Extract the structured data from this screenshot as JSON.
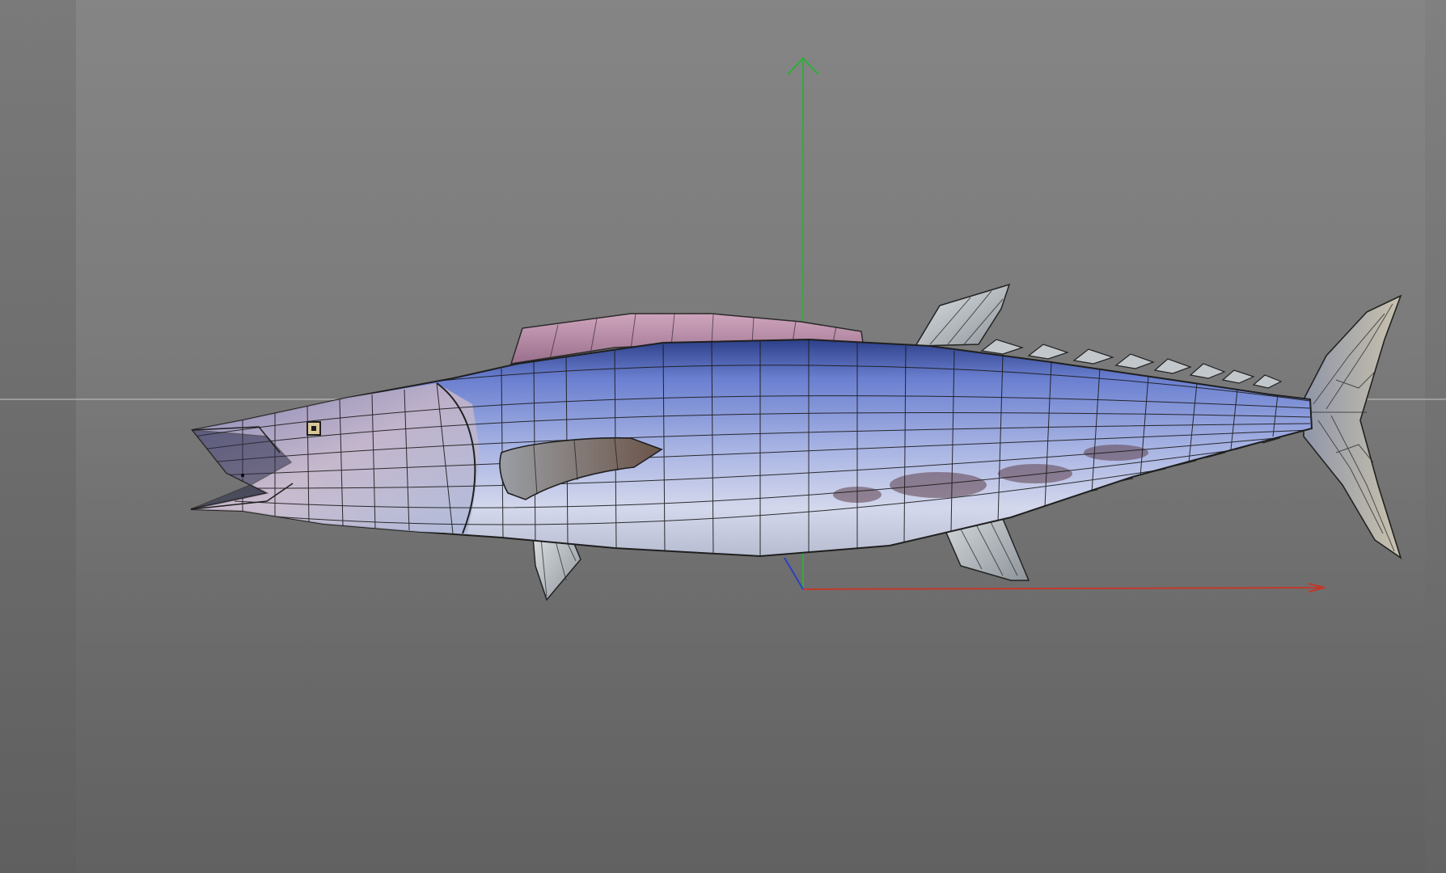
{
  "app": {
    "panel": "3d-viewport",
    "shading": "textured-wireframe"
  },
  "viewport": {
    "background_top": "#858585",
    "background_bottom": "#616161",
    "side_strip": "#6c6c6c"
  },
  "model": {
    "subject": "fish-model",
    "body_color": "#8f9fd0",
    "belly_color": "#d9dcea",
    "back_color": "#3a4e96",
    "dorsal_fin_color": "#b88aa6",
    "fin_color": "#b8bec4",
    "wire_color": "#1f1f1f"
  },
  "gizmo": {
    "x_axis_color": "#c0392b",
    "y_axis_color": "#2fae3a",
    "z_axis_color": "#2e3fc4",
    "ground_line_color": "#c8c8c8"
  }
}
